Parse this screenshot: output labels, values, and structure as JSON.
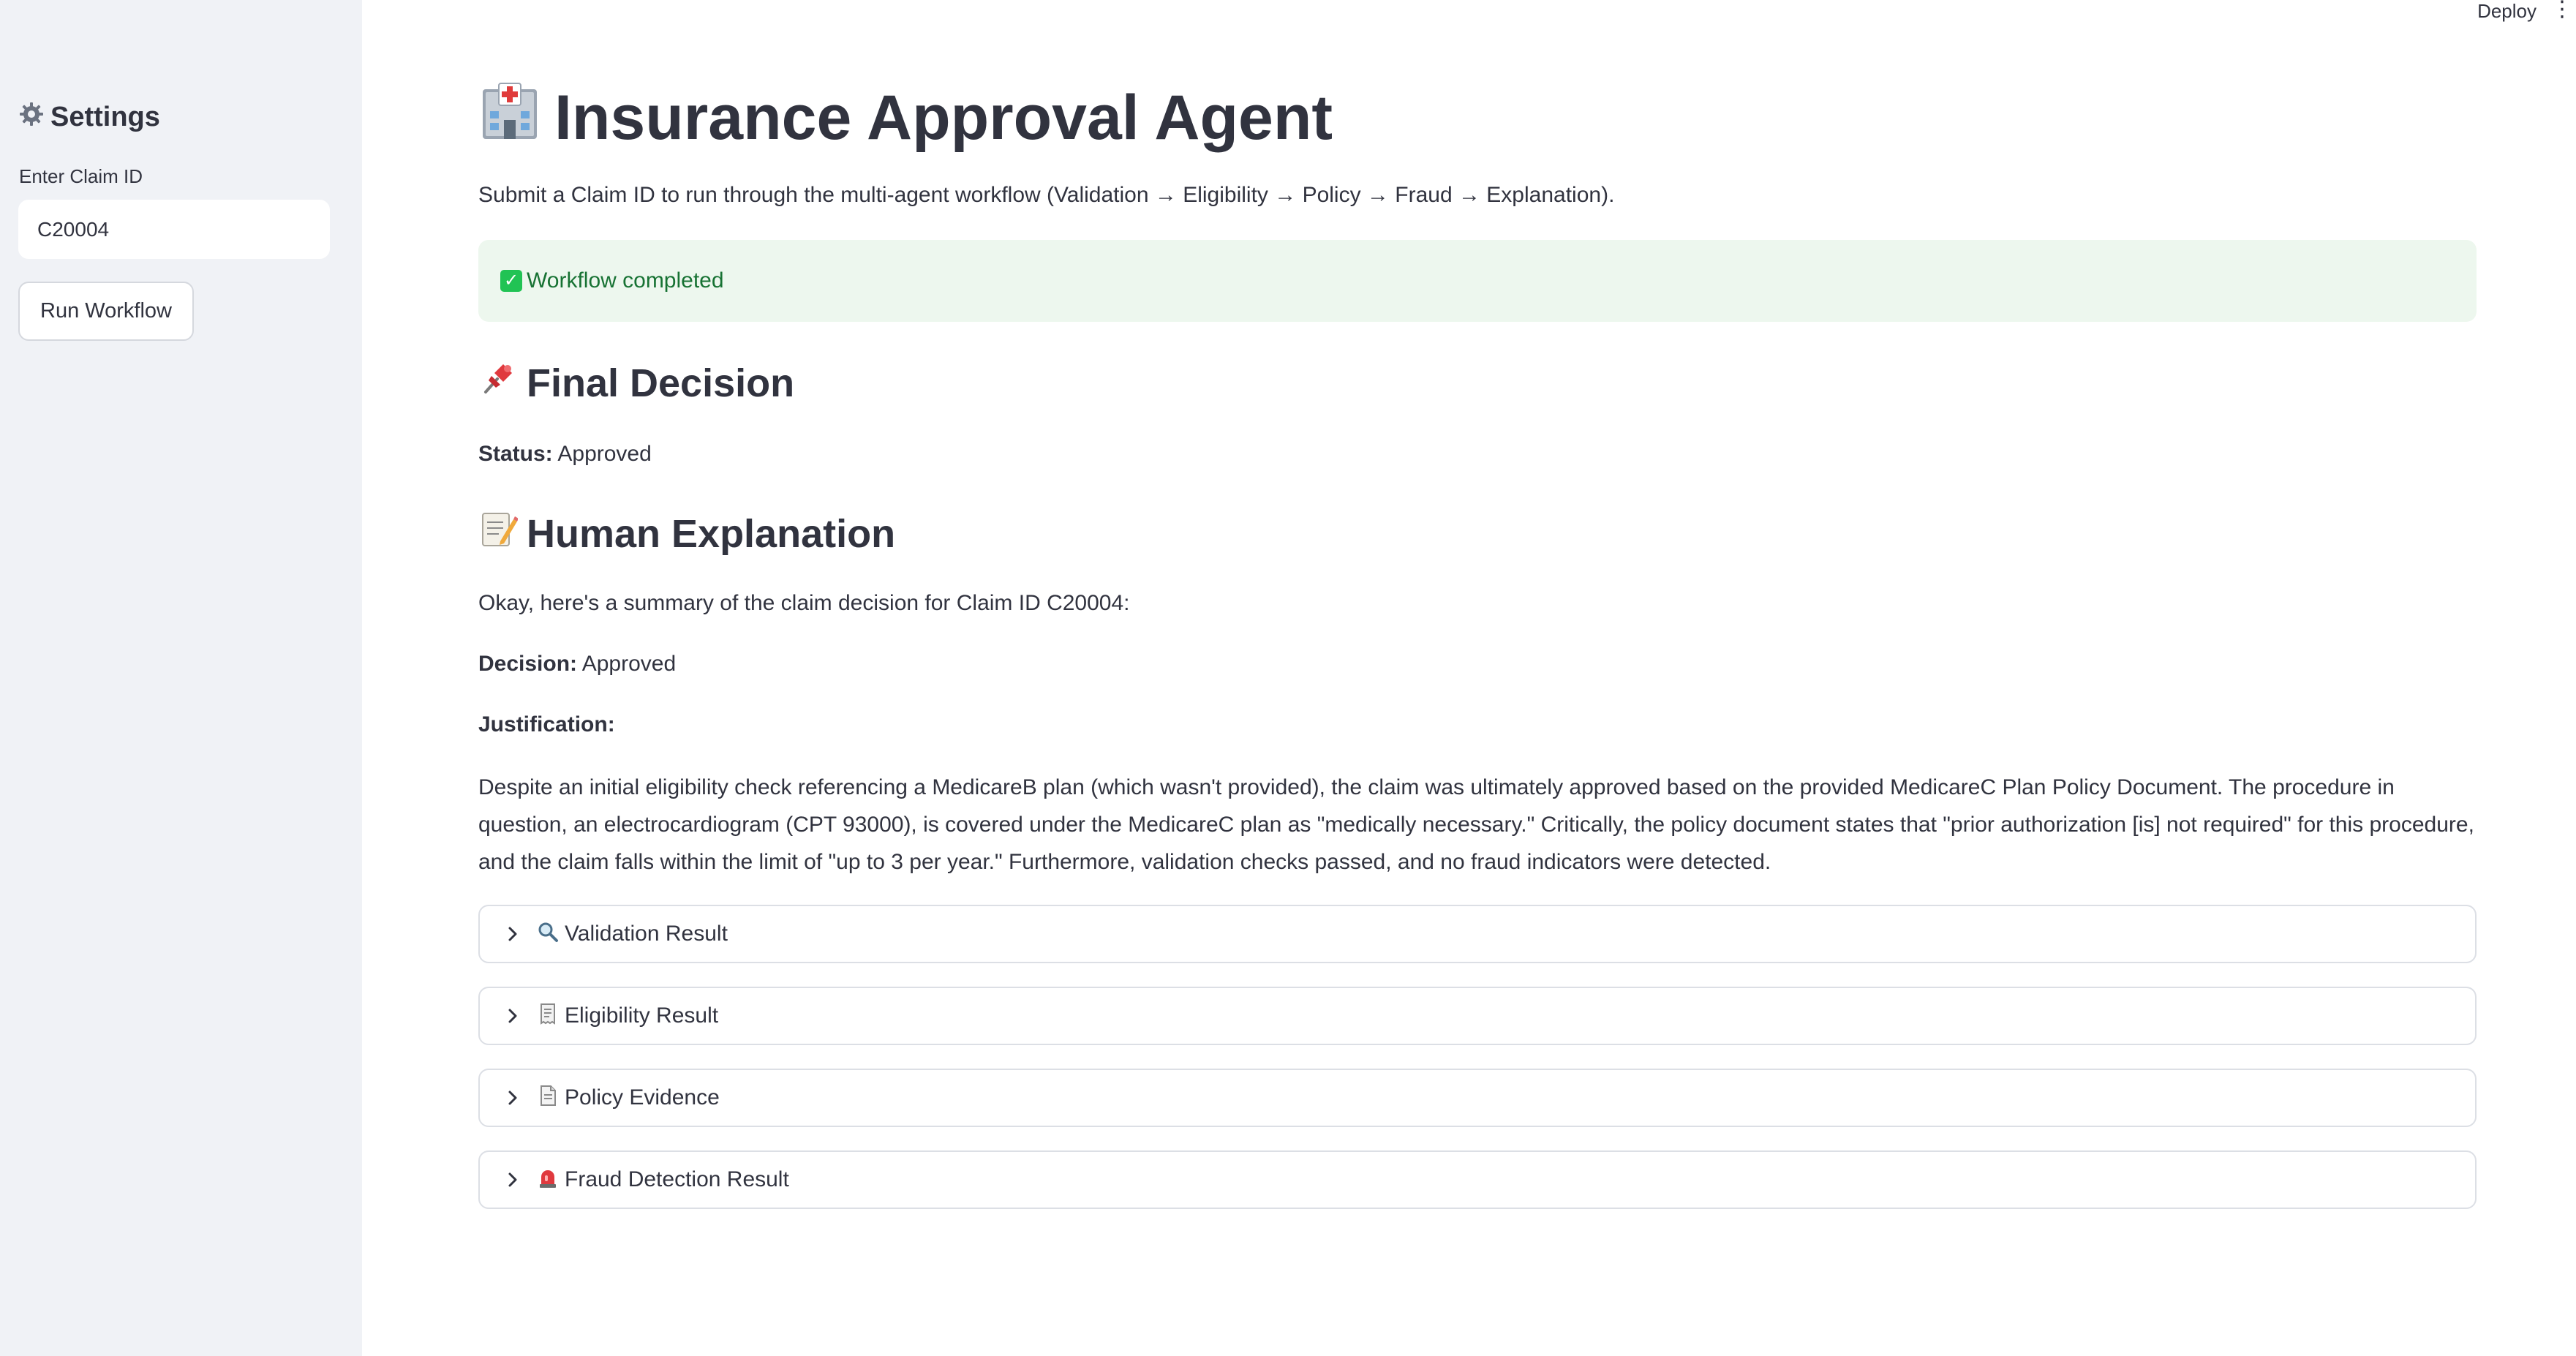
{
  "header": {
    "deploy_label": "Deploy",
    "menu_glyph": "⋮"
  },
  "sidebar": {
    "title": "Settings",
    "title_icon": "gear-icon",
    "claim_label": "Enter Claim ID",
    "claim_value": "C20004",
    "run_button": "Run Workflow"
  },
  "main": {
    "title": "Insurance Approval Agent",
    "title_icon": "hospital-icon",
    "subtitle": "Submit a Claim ID to run through the multi-agent workflow (Validation → Eligibility → Policy → Fraud → Explanation).",
    "success_message": "Workflow completed",
    "success_icon": "check-mark-icon",
    "final_decision": {
      "heading": "Final Decision",
      "icon": "pushpin-icon",
      "status_label": "Status:",
      "status_value": "Approved"
    },
    "explanation": {
      "heading": "Human Explanation",
      "icon": "memo-icon",
      "intro": "Okay, here's a summary of the claim decision for Claim ID C20004:",
      "decision_label": "Decision:",
      "decision_value": "Approved",
      "justification_label": "Justification:",
      "justification_text": "Despite an initial eligibility check referencing a MedicareB plan (which wasn't provided), the claim was ultimately approved based on the provided MedicareC Plan Policy Document. The procedure in question, an electrocardiogram (CPT 93000), is covered under the MedicareC plan as \"medically necessary.\" Critically, the policy document states that \"prior authorization [is] not required\" for this procedure, and the claim falls within the limit of \"up to 3 per year.\" Furthermore, validation checks passed, and no fraud indicators were detected."
    },
    "expanders": [
      {
        "label": "Validation Result",
        "icon": "magnifying-glass-icon"
      },
      {
        "label": "Eligibility Result",
        "icon": "receipt-icon"
      },
      {
        "label": "Policy Evidence",
        "icon": "page-icon"
      },
      {
        "label": "Fraud Detection Result",
        "icon": "siren-icon"
      }
    ]
  },
  "colors": {
    "sidebar_bg": "#f0f2f6",
    "text": "#31333f",
    "success_bg": "#edf7ee",
    "success_text": "#177233",
    "border": "#dcdfe5"
  }
}
